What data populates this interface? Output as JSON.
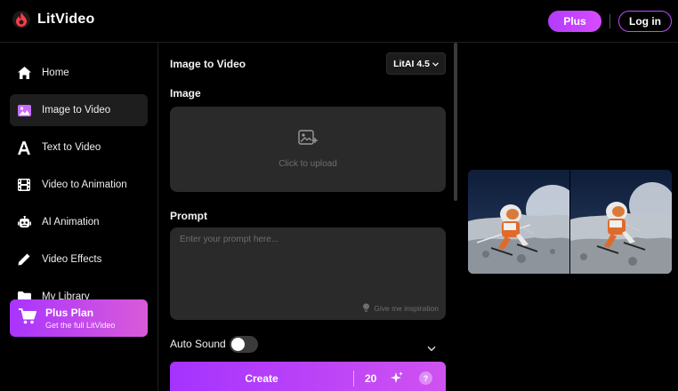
{
  "header": {
    "brand": "LitVideo",
    "plus_label": "Plus",
    "login_label": "Log in"
  },
  "sidebar": {
    "items": [
      {
        "label": "Home",
        "icon": "home-icon"
      },
      {
        "label": "Image to Video",
        "icon": "image-icon",
        "active": true
      },
      {
        "label": "Text to Video",
        "icon": "text-a-icon"
      },
      {
        "label": "Video to Animation",
        "icon": "film-icon"
      },
      {
        "label": "AI Animation",
        "icon": "robot-icon"
      },
      {
        "label": "Video Effects",
        "icon": "pen-icon"
      },
      {
        "label": "My Library",
        "icon": "folder-icon"
      }
    ],
    "plan": {
      "title": "Plus Plan",
      "subtitle": "Get the full LitVideo"
    }
  },
  "main": {
    "title": "Image to Video",
    "model": "LitAI 4.5",
    "image_label": "Image",
    "upload_text": "Click to upload",
    "prompt_label": "Prompt",
    "prompt_placeholder": "Enter your prompt here...",
    "inspiration": "Give me inspiration",
    "auto_sound_label": "Auto Sound",
    "auto_sound_on": false,
    "create_label": "Create",
    "credits": "20",
    "help": "?"
  },
  "colors": {
    "accent": "#b23cff",
    "accent_end": "#d84bff",
    "background": "#000000",
    "panel": "#2a2a2a"
  }
}
